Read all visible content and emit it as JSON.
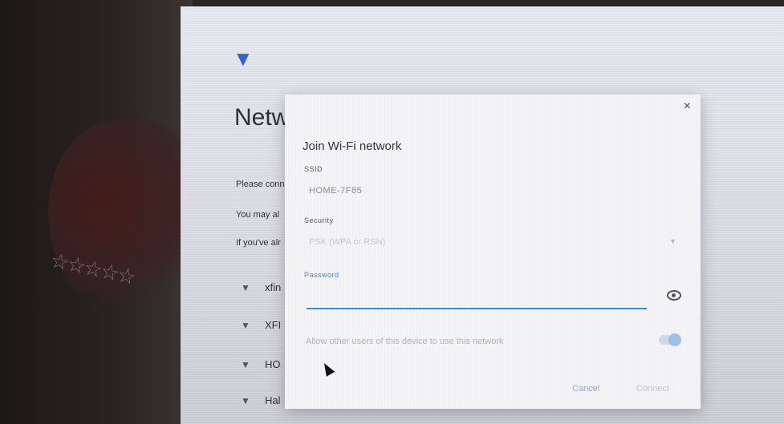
{
  "background": {
    "title": "Netw",
    "lines": [
      "Please conn",
      "You may al",
      "If you've alr"
    ],
    "networks": [
      {
        "name": "xfin",
        "icon": "wifi-icon"
      },
      {
        "name": "XFI",
        "icon": "wifi-locked-icon"
      },
      {
        "name": "HO",
        "icon": "wifi-locked-icon"
      },
      {
        "name": "Hal",
        "icon": "wifi-locked-icon"
      }
    ]
  },
  "dialog": {
    "close_label": "×",
    "title": "Join Wi-Fi network",
    "ssid_label": "SSID",
    "ssid_value": "HOME-7F85",
    "security_label": "Security",
    "security_value": "PSK (WPA or RSN)",
    "password_label": "Password",
    "password_value": "",
    "allow_text": "Allow other users of this device to use this network",
    "allow_enabled": true,
    "cancel_label": "Cancel",
    "connect_label": "Connect"
  },
  "colors": {
    "accent": "#3b8ad8",
    "wifi_icon": "#2f64d6"
  }
}
